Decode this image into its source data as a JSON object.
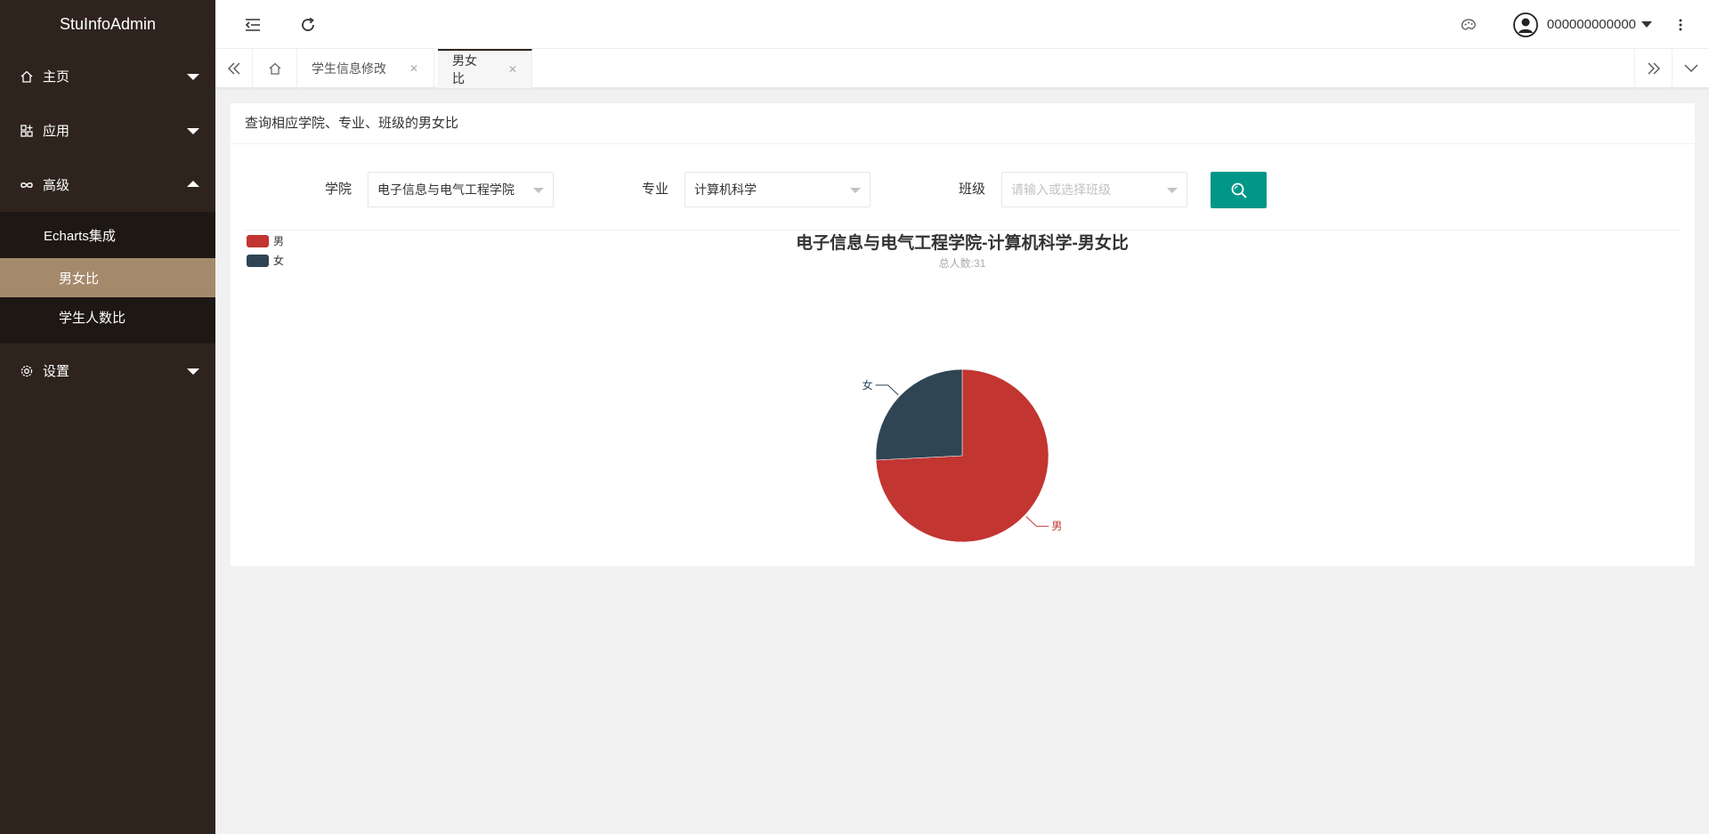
{
  "app": {
    "title": "StuInfoAdmin"
  },
  "sidebar": {
    "items": [
      {
        "label": "主页",
        "icon": "home-icon",
        "expanded": false
      },
      {
        "label": "应用",
        "icon": "apps-icon",
        "expanded": false
      },
      {
        "label": "高级",
        "icon": "infinity-icon",
        "expanded": true
      },
      {
        "label": "设置",
        "icon": "gear-icon",
        "expanded": false
      }
    ],
    "sub": {
      "label": "Echarts集成",
      "children": [
        {
          "label": "男女比",
          "active": true
        },
        {
          "label": "学生人数比",
          "active": false
        }
      ]
    }
  },
  "header": {
    "user_name": "000000000000",
    "icons": [
      "menu-fold-icon",
      "refresh-icon",
      "theme-icon",
      "fullscreen-icon",
      "user-avatar-icon",
      "more-icon"
    ]
  },
  "tabs": {
    "items": [
      {
        "label": "学生信息修改",
        "active": false
      },
      {
        "label": "男女比",
        "active": true
      }
    ]
  },
  "card": {
    "header": "查询相应学院、专业、班级的男女比",
    "filters": {
      "college_label": "学院",
      "college_value": "电子信息与电气工程学院",
      "major_label": "专业",
      "major_value": "计算机科学",
      "class_label": "班级",
      "class_placeholder": "请输入或选择班级"
    }
  },
  "colors": {
    "sidebar_bg": "#2e241d",
    "active_item": "#a5896b",
    "accent": "#009688",
    "male": "#c23531",
    "female": "#2f4554"
  },
  "chart_data": {
    "type": "pie",
    "title": "电子信息与电气工程学院-计算机科学-男女比",
    "subtitle": "总人数:31",
    "legend_position": "top-left",
    "categories": [
      "男",
      "女"
    ],
    "values": [
      23,
      8
    ]
  }
}
